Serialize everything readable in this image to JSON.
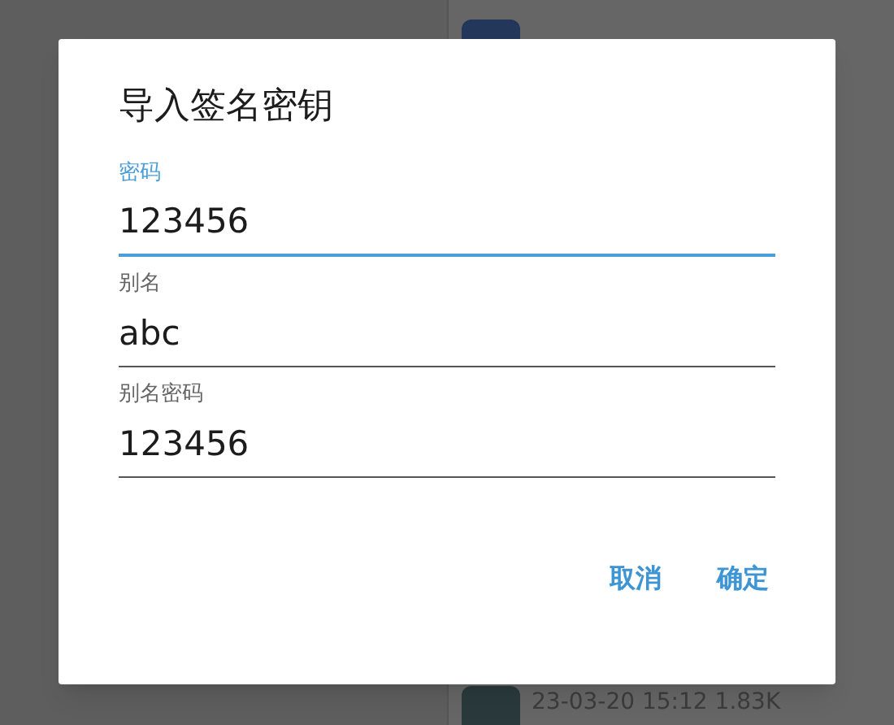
{
  "background": {
    "file_row": {
      "meta": "23-03-20 15:12 1.83K"
    }
  },
  "dialog": {
    "title": "导入签名密钥",
    "fields": [
      {
        "label": "密码",
        "value": "123456",
        "focused": true
      },
      {
        "label": "别名",
        "value": "abc",
        "focused": false
      },
      {
        "label": "别名密码",
        "value": "123456",
        "focused": false
      }
    ],
    "buttons": [
      "取消",
      "确定"
    ]
  }
}
